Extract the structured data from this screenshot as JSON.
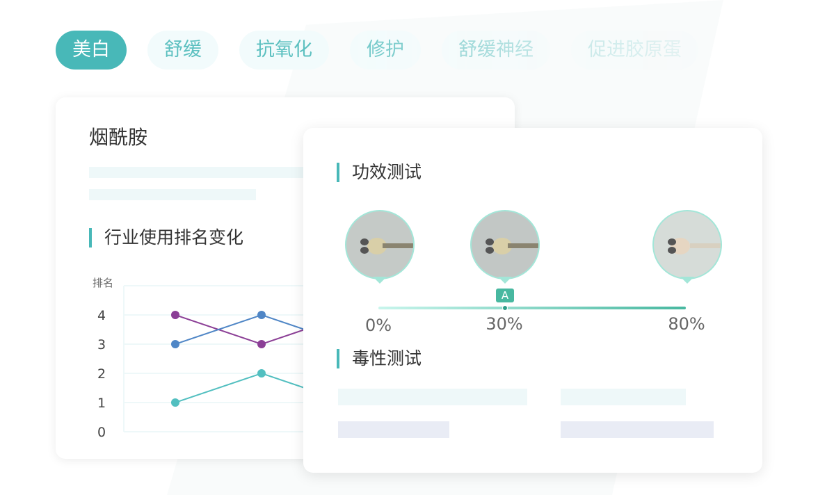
{
  "tabs": [
    "美白",
    "舒缓",
    "抗氧化",
    "修护",
    "舒缓神经",
    "促进胶原蛋"
  ],
  "active_tab": "美白",
  "ingredient_card": {
    "title": "烟酰胺",
    "section": "行业使用排名变化"
  },
  "chart_data": {
    "type": "line",
    "ylabel": "排名",
    "yticks": [
      "0",
      "1",
      "2",
      "3",
      "4"
    ],
    "ylim": [
      0,
      5
    ],
    "series": [
      {
        "color": "#8b3f96",
        "values": [
          4,
          3,
          4
        ]
      },
      {
        "color": "#4f86c6",
        "values": [
          3,
          4,
          3
        ]
      },
      {
        "color": "#52bfc0",
        "values": [
          1,
          2,
          1
        ]
      }
    ]
  },
  "test_card": {
    "efficacy_title": "功效测试",
    "toxicity_title": "毒性测试",
    "slider": {
      "marker_label": "A",
      "value_percent": 30,
      "labels": [
        "0%",
        "30%",
        "80%"
      ]
    },
    "images": [
      "zebrafish-0",
      "zebrafish-30",
      "zebrafish-80"
    ]
  },
  "colors": {
    "accent": "#48b8b8"
  }
}
